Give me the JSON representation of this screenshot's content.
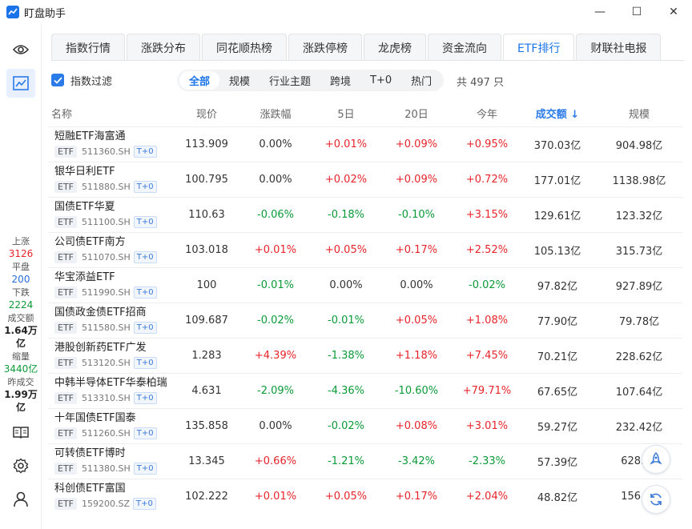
{
  "app": {
    "title": "盯盘助手"
  },
  "window": {
    "minimize": "—",
    "maximize": "☐",
    "close": "✕"
  },
  "sidebar": {
    "icons": [
      "eye-icon",
      "chart-icon",
      "book-icon",
      "gear-icon",
      "user-icon"
    ],
    "stats": [
      {
        "label": "上涨",
        "value": "3126",
        "color": "red"
      },
      {
        "label": "平盘",
        "value": "200",
        "color": "blue"
      },
      {
        "label": "下跌",
        "value": "2224",
        "color": "green"
      },
      {
        "label": "成交额",
        "value": "1.64万亿",
        "color": "bold"
      },
      {
        "label": "缩量",
        "value": "3440亿",
        "color": "green"
      },
      {
        "label": "昨成交",
        "value": "1.99万亿",
        "color": "bold"
      }
    ]
  },
  "tabs": [
    "指数行情",
    "涨跌分布",
    "同花顺热榜",
    "涨跌停榜",
    "龙虎榜",
    "资金流向",
    "ETF排行",
    "财联社电报"
  ],
  "active_tab": 6,
  "filter": {
    "checkbox_label": "指数过滤",
    "segments": [
      "全部",
      "规模",
      "行业主题",
      "跨境",
      "T+0",
      "热门"
    ],
    "active_segment": 0,
    "count_text": "共 497 只"
  },
  "table": {
    "columns": [
      "名称",
      "现价",
      "涨跌幅",
      "5日",
      "20日",
      "今年",
      "成交额 ↓",
      "规模"
    ],
    "sorted_column": 6,
    "badge": "ETF",
    "t0_label": "T+0",
    "rows": [
      {
        "name": "短融ETF海富通",
        "code": "511360.SH",
        "price": "113.909",
        "chg": "0.00%",
        "d5": "+0.01%",
        "d20": "+0.09%",
        "ytd": "+0.95%",
        "amount": "370.03亿",
        "size": "904.98亿"
      },
      {
        "name": "银华日利ETF",
        "code": "511880.SH",
        "price": "100.795",
        "chg": "0.00%",
        "d5": "+0.02%",
        "d20": "+0.09%",
        "ytd": "+0.72%",
        "amount": "177.01亿",
        "size": "1138.98亿"
      },
      {
        "name": "国债ETF华夏",
        "code": "511100.SH",
        "price": "110.63",
        "chg": "-0.06%",
        "d5": "-0.18%",
        "d20": "-0.10%",
        "ytd": "+3.15%",
        "amount": "129.61亿",
        "size": "123.32亿"
      },
      {
        "name": "公司债ETF南方",
        "code": "511070.SH",
        "price": "103.018",
        "chg": "+0.01%",
        "d5": "+0.05%",
        "d20": "+0.17%",
        "ytd": "+2.52%",
        "amount": "105.13亿",
        "size": "315.73亿"
      },
      {
        "name": "华宝添益ETF",
        "code": "511990.SH",
        "price": "100",
        "chg": "-0.01%",
        "d5": "0.00%",
        "d20": "0.00%",
        "ytd": "-0.02%",
        "amount": "97.82亿",
        "size": "927.89亿"
      },
      {
        "name": "国债政金债ETF招商",
        "code": "511580.SH",
        "price": "109.687",
        "chg": "-0.02%",
        "d5": "-0.01%",
        "d20": "+0.05%",
        "ytd": "+1.08%",
        "amount": "77.90亿",
        "size": "79.78亿"
      },
      {
        "name": "港股创新药ETF广发",
        "code": "513120.SH",
        "price": "1.283",
        "chg": "+4.39%",
        "d5": "-1.38%",
        "d20": "+1.18%",
        "ytd": "+7.45%",
        "amount": "70.21亿",
        "size": "228.62亿"
      },
      {
        "name": "中韩半导体ETF华泰柏瑞",
        "code": "513310.SH",
        "price": "4.631",
        "chg": "-2.09%",
        "d5": "-4.36%",
        "d20": "-10.60%",
        "ytd": "+79.71%",
        "amount": "67.65亿",
        "size": "107.64亿"
      },
      {
        "name": "十年国债ETF国泰",
        "code": "511260.SH",
        "price": "135.858",
        "chg": "0.00%",
        "d5": "-0.02%",
        "d20": "+0.08%",
        "ytd": "+3.01%",
        "amount": "59.27亿",
        "size": "232.42亿"
      },
      {
        "name": "可转债ETF博时",
        "code": "511380.SH",
        "price": "13.345",
        "chg": "+0.66%",
        "d5": "-1.21%",
        "d20": "-3.42%",
        "ytd": "-2.33%",
        "amount": "57.39亿",
        "size": "628.94"
      },
      {
        "name": "科创债ETF富国",
        "code": "159200.SZ",
        "price": "102.222",
        "chg": "+0.01%",
        "d5": "+0.05%",
        "d20": "+0.17%",
        "ytd": "+2.04%",
        "amount": "48.82亿",
        "size": "156.71"
      }
    ]
  },
  "float_buttons": [
    "rocket-icon",
    "refresh-icon"
  ],
  "colors": {
    "accent": "#1a73e8",
    "up": "#e8242b",
    "down": "#0a9a38",
    "flat": "#333333"
  }
}
